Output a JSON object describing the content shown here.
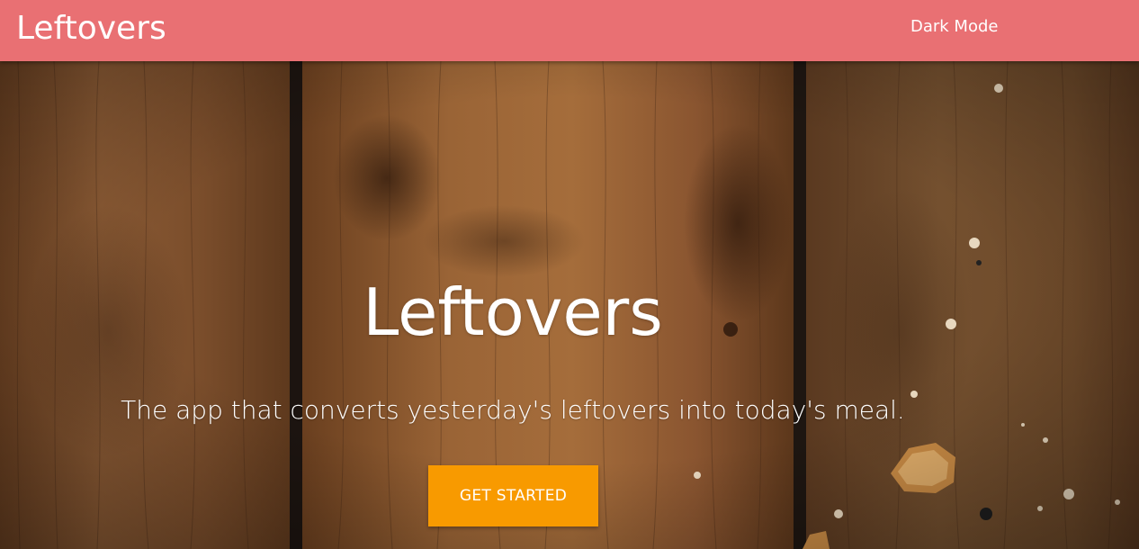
{
  "navbar": {
    "brand": "Leftovers",
    "dark_mode_label": "Dark Mode",
    "color": "#e97073"
  },
  "hero": {
    "title": "Leftovers",
    "subtitle": "The app that converts yesterday's leftovers into today's meal.",
    "cta_label": "GET STARTED",
    "cta_color": "#f89a00",
    "background": "wood-planks-photo"
  }
}
